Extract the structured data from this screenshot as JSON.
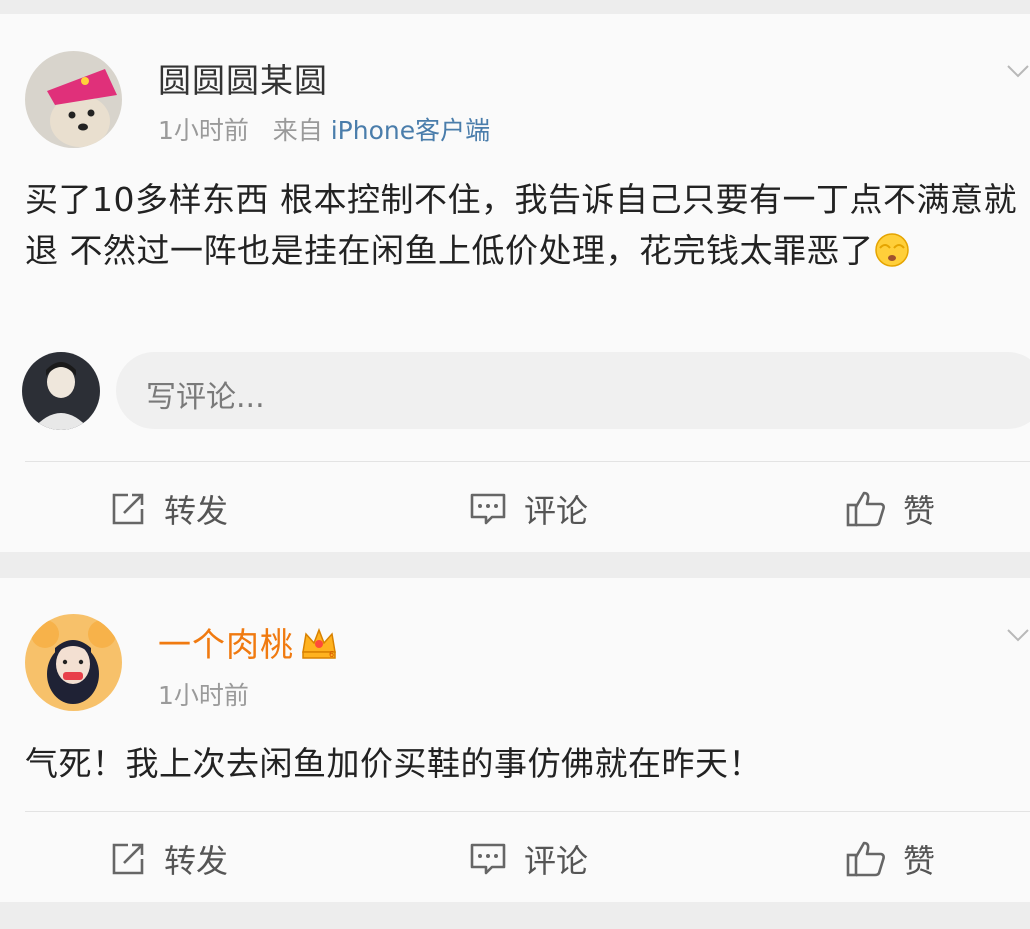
{
  "posts": [
    {
      "username": "圆圆圆某圆",
      "time": "1小时前",
      "source_prefix": "来自",
      "source": "iPhone客户端",
      "text": "买了10多样东西 根本控制不住，我告诉自己只要有一丁点不满意就退 不然过一阵也是挂在闲鱼上低价处理，花完钱太罪恶了",
      "avatar_icon": "dog-avatar",
      "username_color": "#333333"
    },
    {
      "username": "一个肉桃",
      "time": "1小时前",
      "text": "气死！我上次去闲鱼加价买鞋的事仿佛就在昨天！",
      "avatar_icon": "girl-avatar",
      "badge_icon": "crown-vip-icon",
      "username_color": "#f07a10"
    }
  ],
  "comment_box": {
    "placeholder": "写评论..."
  },
  "actions": {
    "repost": "转发",
    "comment": "评论",
    "like": "赞"
  },
  "colors": {
    "link": "#4a7dab",
    "vip_name": "#f07a10",
    "page_bg": "#ededed",
    "card_bg": "#fafafa"
  }
}
